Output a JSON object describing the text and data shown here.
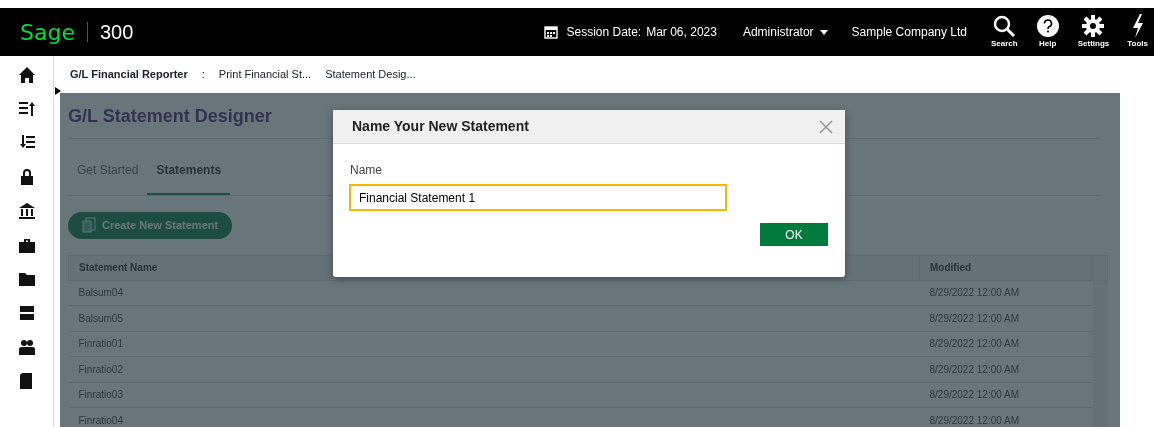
{
  "header": {
    "logo": "Sage",
    "product": "300",
    "session_label": "Session Date:",
    "session_date": "Mar 06, 2023",
    "user": "Administrator",
    "company": "Sample Company Ltd",
    "tools": [
      {
        "kind": "search",
        "label": "Search"
      },
      {
        "kind": "help",
        "label": "Help"
      },
      {
        "kind": "settings",
        "label": "Settings"
      },
      {
        "kind": "tools",
        "label": "Tools"
      }
    ]
  },
  "breadcrumb": [
    {
      "label": "G/L Financial Reporter",
      "current": true
    },
    {
      "label": ":",
      "current": false
    },
    {
      "label": "Print Financial St...",
      "current": false
    },
    {
      "label": "Statement Desig...",
      "current": false
    }
  ],
  "page_title": "G/L Statement Designer",
  "tabs": [
    {
      "label": "Get Started",
      "selected": false
    },
    {
      "label": "Statements",
      "selected": true
    }
  ],
  "create_button": "Create New Statement",
  "table": {
    "columns": [
      "Statement Name",
      "Modified"
    ],
    "rows": [
      {
        "name": "Balsum04",
        "modified": "8/29/2022 12:00 AM"
      },
      {
        "name": "Balsum05",
        "modified": "8/29/2022 12:00 AM"
      },
      {
        "name": "Finratio01",
        "modified": "8/29/2022 12:00 AM"
      },
      {
        "name": "Finratio02",
        "modified": "8/29/2022 12:00 AM"
      },
      {
        "name": "Finratio03",
        "modified": "8/29/2022 12:00 AM"
      },
      {
        "name": "Finratio04",
        "modified": "8/29/2022 12:00 AM"
      }
    ]
  },
  "dialog": {
    "title": "Name Your New Statement",
    "field_label": "Name",
    "value": "Financial Statement 1",
    "ok": "OK"
  }
}
